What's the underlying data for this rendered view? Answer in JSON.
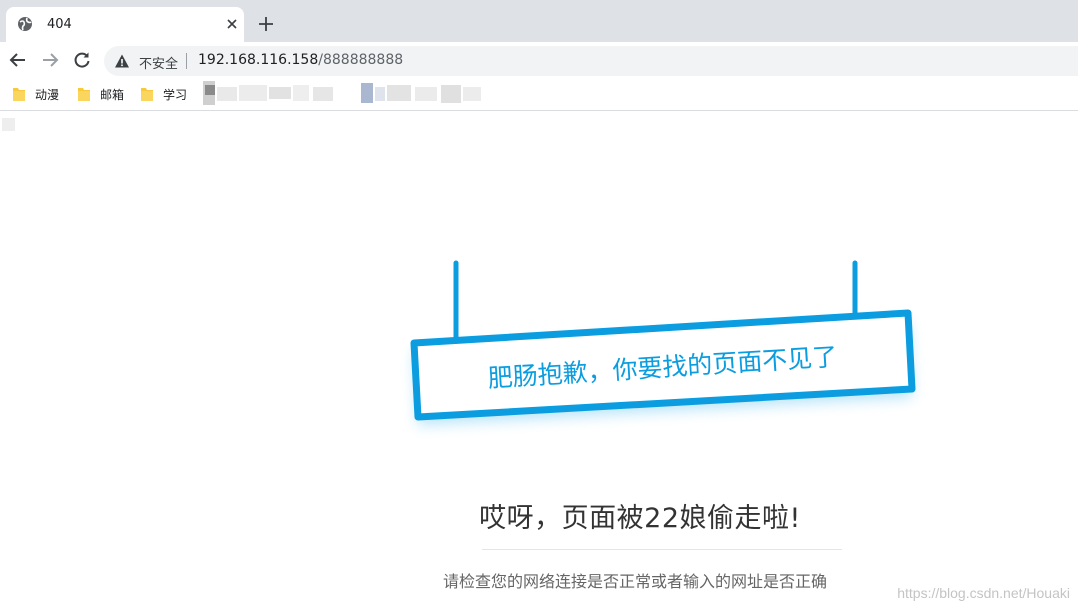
{
  "tab": {
    "title": "404"
  },
  "toolbar": {
    "security_label": "不安全",
    "url_host": "192.168.116.158",
    "url_path": "/888888888"
  },
  "bookmarks": [
    {
      "label": "动漫",
      "icon": "folder-icon"
    },
    {
      "label": "邮箱",
      "icon": "folder-icon"
    },
    {
      "label": "学习",
      "icon": "folder-icon"
    }
  ],
  "page": {
    "sign_text": "肥肠抱歉，你要找的页面不见了",
    "headline": "哎呀，页面被22娘偷走啦!",
    "subline": "请检查您的网络连接是否正常或者输入的网址是否正确"
  },
  "watermark": "https://blog.csdn.net/Houaki",
  "colors": {
    "accent": "#0b9ddf",
    "tabstrip_bg": "#dee1e6",
    "omnibox_bg": "#f1f3f4"
  }
}
